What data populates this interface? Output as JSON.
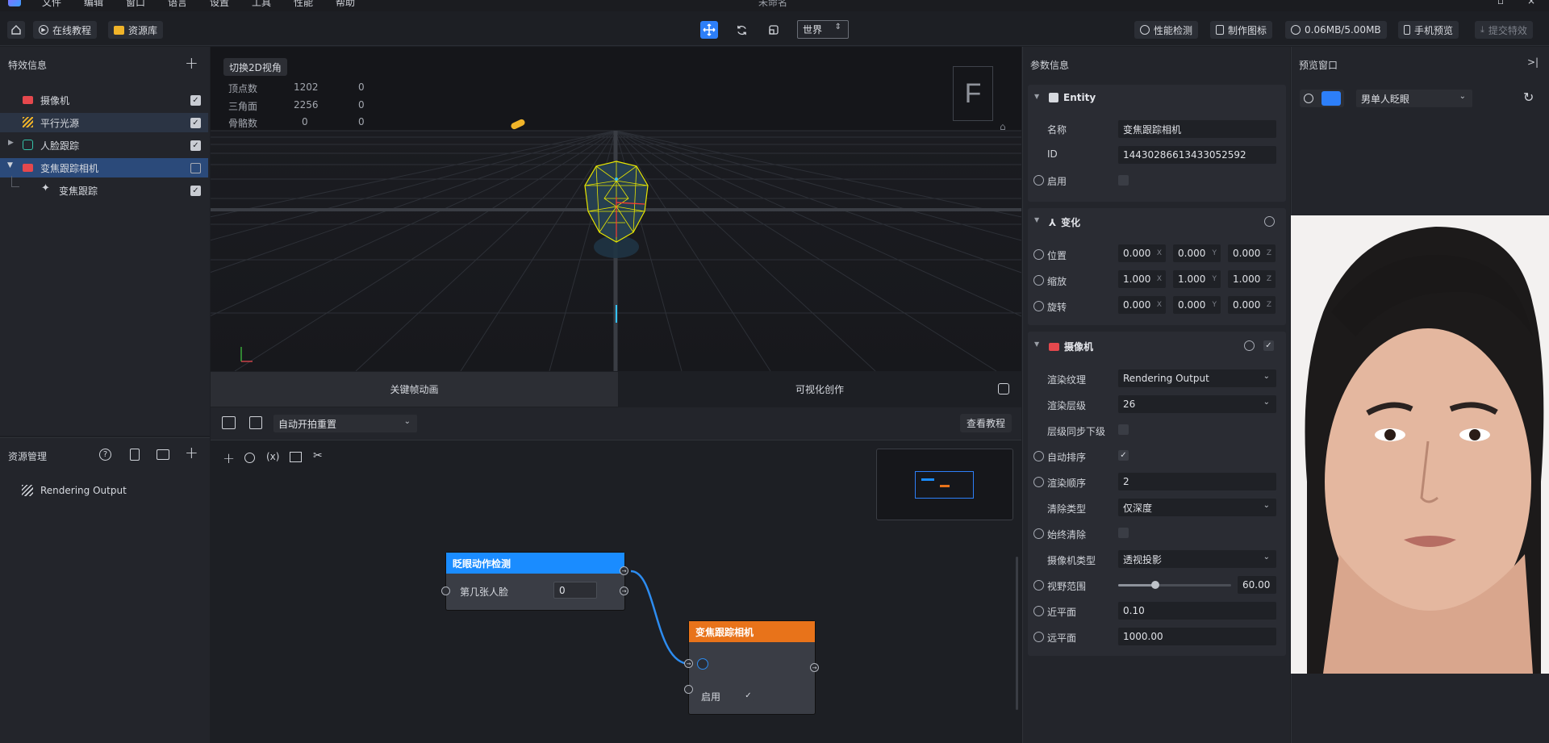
{
  "menu": {
    "items": [
      "文件",
      "编辑",
      "窗口",
      "语言",
      "设置",
      "工具",
      "性能",
      "帮助"
    ],
    "title": "未命名"
  },
  "toolbar": {
    "tutorial_label": "在线教程",
    "assets_label": "资源库",
    "space_select": "世界",
    "perf_label": "性能检测",
    "make_icon_label": "制作图标",
    "size_label": "0.06MB/5.00MB",
    "phone_preview_label": "手机预览",
    "submit_label": "提交特效"
  },
  "effects": {
    "title": "特效信息",
    "items": [
      {
        "label": "摄像机",
        "checked": true
      },
      {
        "label": "平行光源",
        "checked": true
      },
      {
        "label": "人脸跟踪",
        "checked": true
      },
      {
        "label": "变焦跟踪相机",
        "checked": false
      },
      {
        "label": "变焦跟踪",
        "checked": true
      }
    ]
  },
  "assets": {
    "title": "资源管理",
    "items": [
      {
        "label": "Rendering Output"
      }
    ]
  },
  "viewport": {
    "toggle_2d_label": "切换2D视角",
    "stats": [
      {
        "label": "顶点数",
        "v1": "1202",
        "v2": "0"
      },
      {
        "label": "三角面",
        "v1": "2256",
        "v2": "0"
      },
      {
        "label": "骨骼数",
        "v1": "0",
        "v2": "0"
      }
    ],
    "gizmo_letter": "F"
  },
  "bottom": {
    "tab_keyframe": "关键帧动画",
    "tab_visual": "可视化创作",
    "graph_select": "自动开拍重置",
    "tutorial_btn": "查看教程"
  },
  "graph": {
    "node1": {
      "title": "眨眼动作检测",
      "param_label": "第几张人脸",
      "param_value": "0"
    },
    "node2": {
      "title": "变焦跟踪相机",
      "enable_label": "启用"
    },
    "colors": {
      "node1_header": "#1a8cff",
      "node2_header": "#e8731a",
      "link": "#2d8cf0"
    }
  },
  "params": {
    "title": "参数信息",
    "entity": {
      "title": "Entity",
      "name_label": "名称",
      "name_value": "变焦跟踪相机",
      "id_label": "ID",
      "id_value": "14430286613433052592",
      "enable_label": "启用"
    },
    "transform": {
      "title": "变化",
      "rows": [
        {
          "label": "位置",
          "x": "0.000",
          "y": "0.000",
          "z": "0.000"
        },
        {
          "label": "缩放",
          "x": "1.000",
          "y": "1.000",
          "z": "1.000"
        },
        {
          "label": "旋转",
          "x": "0.000",
          "y": "0.000",
          "z": "0.000"
        }
      ],
      "axes": [
        "X",
        "Y",
        "Z"
      ]
    },
    "camera": {
      "title": "摄像机",
      "render_texture_label": "渲染纹理",
      "render_texture_value": "Rendering Output",
      "render_layer_label": "渲染层级",
      "render_layer_value": "26",
      "layer_sync_label": "层级同步下级",
      "auto_sort_label": "自动排序",
      "render_order_label": "渲染顺序",
      "render_order_value": "2",
      "clear_type_label": "清除类型",
      "clear_type_value": "仅深度",
      "always_clear_label": "始终清除",
      "camera_type_label": "摄像机类型",
      "camera_type_value": "透视投影",
      "fov_label": "视野范围",
      "fov_value": "60.00",
      "fov_fraction": 0.33,
      "near_label": "近平面",
      "near_value": "0.10",
      "far_label": "远平面",
      "far_value": "1000.00"
    }
  },
  "preview": {
    "title": "预览窗口",
    "model_select": "男单人眨眼"
  }
}
